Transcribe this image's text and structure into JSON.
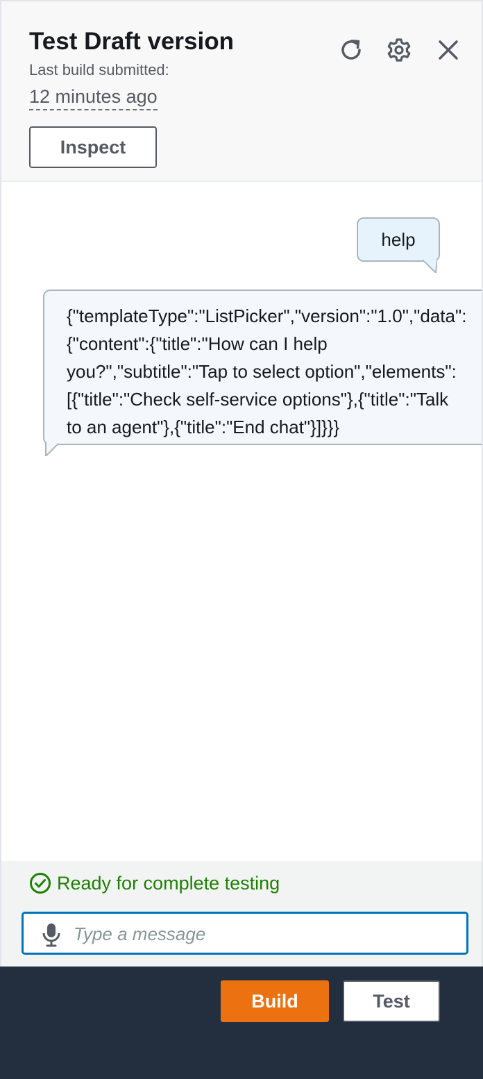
{
  "header": {
    "title": "Test Draft version",
    "subtitle": "Last build submitted:",
    "time_ago": "12 minutes ago",
    "inspect_label": "Inspect",
    "icons": [
      "refresh-icon",
      "settings-icon",
      "close-icon"
    ]
  },
  "chat": {
    "user_message": "help",
    "bot_message_lines": [
      "{\"templateType\":\"ListPicker\",\"version\":\"1.0\",\"data\":",
      "{\"content\":{\"title\":\"How can I help",
      "you?\",\"subtitle\":\"Tap to select option\",\"elements\":",
      "[{\"title\":\"Check self-service options\"},{\"title\":\"Talk",
      "to an agent\"},{\"title\":\"End chat\"}]}}}"
    ]
  },
  "status": {
    "text": "Ready for complete testing",
    "icon": "check-circle-icon"
  },
  "input": {
    "placeholder": "Type a message",
    "value": "",
    "icon": "microphone-icon"
  },
  "actions": {
    "build_label": "Build",
    "test_label": "Test"
  },
  "colors": {
    "accent": "#0073bb",
    "success": "#1d8102",
    "primary_button": "#ec7211",
    "bottom_bar": "#232f3e"
  }
}
